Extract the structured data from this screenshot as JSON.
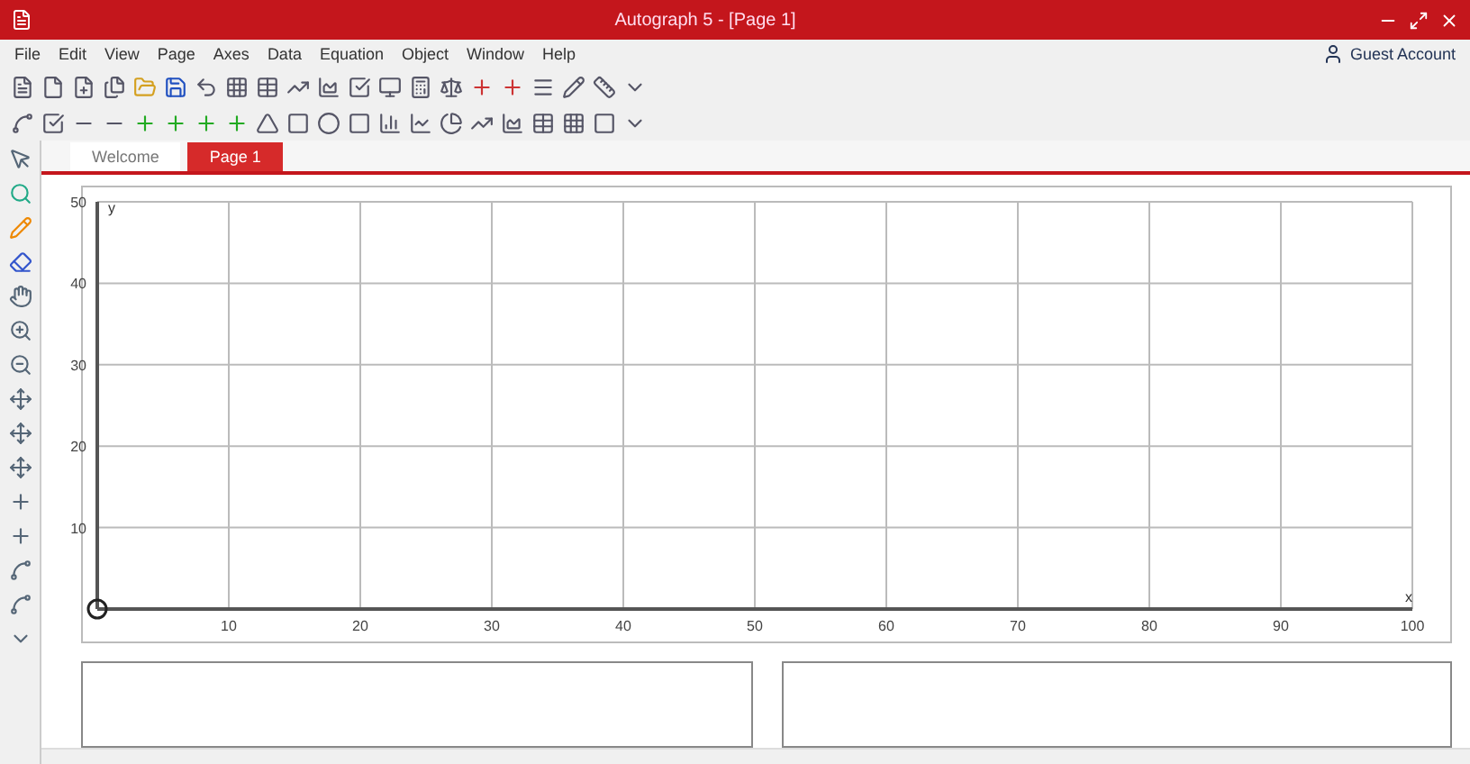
{
  "window": {
    "title": "Autograph 5 - [Page 1]"
  },
  "menu": [
    "File",
    "Edit",
    "View",
    "Page",
    "Axes",
    "Data",
    "Equation",
    "Object",
    "Window",
    "Help"
  ],
  "account": {
    "name": "Guest Account"
  },
  "tabs": [
    {
      "label": "Welcome",
      "selected": false
    },
    {
      "label": "Page 1",
      "selected": true
    }
  ],
  "graph": {
    "chart_data": {
      "type": "line",
      "grid": true,
      "xlabel": "x",
      "ylabel": "y",
      "xlim": [
        0,
        100
      ],
      "ylim": [
        0,
        50
      ],
      "xticks": [
        10,
        20,
        30,
        40,
        50,
        60,
        70,
        80,
        90,
        100
      ],
      "yticks": [
        10,
        20,
        30,
        40,
        50
      ]
    }
  }
}
